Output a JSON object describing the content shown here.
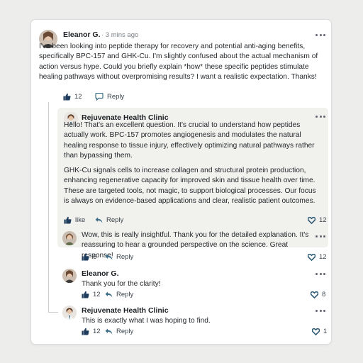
{
  "thread": {
    "main": {
      "author": "Eleanor G.",
      "time": "· 3 mins ago",
      "text": "I've been looking into peptide therapy for recovery and potential anti-aging benefits, specifically BPC-157 and GHK-Cu. I'm slightly confused about the actual mechanism of action versus hype. Could you briefly explain *how* these specific peptides stimulate healing pathways without overpromising results? I want a realistic expectation. Thanks!",
      "likes": "12",
      "reply_label": "Reply"
    },
    "clinic_reply": {
      "author": "Rejuvenate Health Clinic",
      "para1": "Hello! That's an excellent question. It's crucial to understand how peptides actually work. BPC-157 promotes angiogenesis and modulates the natural healing response to tissue injury, effectively optimizing natural pathways rather than bypassing them.",
      "para2": "GHK-Cu signals cells to increase collagen and structural protein production, enhancing regenerative capacity for improved skin and tissue health over time. These are targeted tools, not magic, to support biological processes. Our focus is always on evidence-based applications and clear, realistic patient outcomes.",
      "like_label": "like",
      "reply_label": "Reply",
      "hearts": "12"
    },
    "reply2": {
      "text": "Wow, this is really insightful. Thank you for the detailed explanation. It's reassuring to hear a grounded perspective on the science. Great response!",
      "likes": "6",
      "reply_label": "Reply",
      "hearts": "12"
    },
    "reply3": {
      "author": "Eleanor G.",
      "text": "Thank you for the clarity!",
      "likes": "12",
      "reply_label": "Reply",
      "hearts": "8"
    },
    "reply4": {
      "author": "Rejuvenate Health Clinic",
      "text": "This is exactly what I was hoping to find.",
      "likes": "12",
      "reply_label": "Reply",
      "hearts": "1"
    }
  },
  "colors": {
    "icon_navy": "#1f3c5c",
    "icon_teal": "#3f6e86",
    "highlight_bg": "#f1f1ee"
  },
  "icons": [
    "thumbs-up-icon",
    "reply-arrow-icon",
    "heart-icon",
    "more-options-icon",
    "avatar"
  ]
}
